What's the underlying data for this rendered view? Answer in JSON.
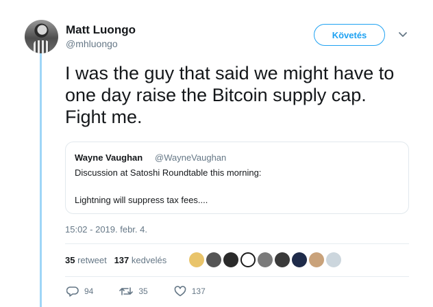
{
  "author": {
    "name": "Matt Luongo",
    "handle": "@mhluongo"
  },
  "follow_button": {
    "label": "Követés"
  },
  "tweet": {
    "text": "I was the guy that said we might have to\none day raise the Bitcoin supply cap.\nFight me."
  },
  "quoted_tweet": {
    "author_name": "Wayne Vaughan",
    "author_handle": "@WayneVaughan",
    "line1": "Discussion at Satoshi Roundtable this morning:",
    "line2": "Lightning will suppress tax fees...."
  },
  "timestamp": "15:02 - 2019. febr. 4.",
  "stats": {
    "retweets_count": "35",
    "retweets_label": "retweet",
    "likes_count": "137",
    "likes_label": "kedvelés"
  },
  "likers": [
    {
      "color": "#e9c46a"
    },
    {
      "color": "#555555"
    },
    {
      "color": "#2a2a2a"
    },
    {
      "color": "#ffffff"
    },
    {
      "color": "#7a7a7a"
    },
    {
      "color": "#3a3a3a"
    },
    {
      "color": "#1f2b4a"
    },
    {
      "color": "#c9a27a"
    },
    {
      "color": "#ccd6dd"
    }
  ],
  "actions": {
    "replies": "94",
    "retweets": "35",
    "likes": "137"
  },
  "colors": {
    "accent": "#1da1f2",
    "thread_line": "#9fd6f7",
    "muted": "#657786"
  }
}
